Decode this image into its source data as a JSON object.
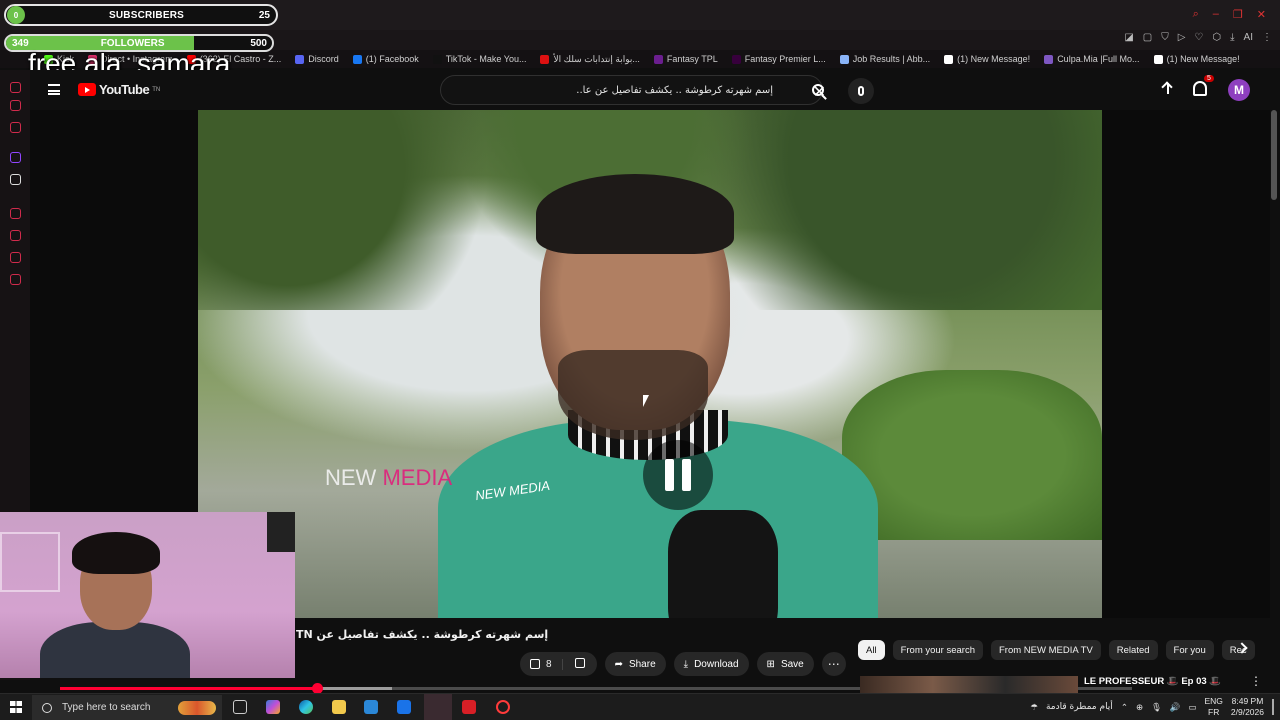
{
  "overlay": {
    "subscribers": {
      "label": "SUBSCRIBERS",
      "count": "25",
      "progress": 0.05
    },
    "followers": {
      "current": "349",
      "label": "FOLLOWERS",
      "goal": "500",
      "progress": 0.698
    },
    "handle": "free ala_samara"
  },
  "browser": {
    "bookmarks": [
      {
        "label": "Kick",
        "color": "#53fc18"
      },
      {
        "label": "Direct • Instagram",
        "color": "#e1306c"
      },
      {
        "label": "(362) El Castro - Z...",
        "color": "#ff0000"
      },
      {
        "label": "Discord",
        "color": "#5865f2"
      },
      {
        "label": "(1) Facebook",
        "color": "#1877f2"
      },
      {
        "label": "TikTok - Make You...",
        "color": "#111111"
      },
      {
        "label": "بوابة إنتدابات سلك الأ...",
        "color": "#d11"
      },
      {
        "label": "Fantasy TPL",
        "color": "#6b1e8f"
      },
      {
        "label": "Fantasy Premier L...",
        "color": "#37003c"
      },
      {
        "label": "Job Results | Abb...",
        "color": "#8ab4f8"
      },
      {
        "label": "(1) New Message!",
        "color": "#ffffff"
      },
      {
        "label": "Culpa.Mia |Full Mo...",
        "color": "#7e57c2"
      },
      {
        "label": "(1) New Message!",
        "color": "#ffffff"
      }
    ]
  },
  "youtube": {
    "logo_text": "YouTube",
    "logo_region": "TN",
    "search_value": "إسم شهرته كرطوشة .. يكشف تفاصيل عن عا..",
    "notification_count": "5",
    "avatar_letter": "M",
    "video": {
      "watermark_main": "NEW ",
      "watermark_accent": "MEDIA",
      "mic_label": "NEW MEDIA",
      "progress": 0.24,
      "buffered": 0.31
    },
    "title": "إسم شهرته كرطوشة .. يكشف تفاصيل عن TN",
    "actions": {
      "likes": "8",
      "share": "Share",
      "download": "Download",
      "save": "Save"
    },
    "chips": [
      "All",
      "From your search",
      "From NEW MEDIA TV",
      "Related",
      "For you",
      "Rec"
    ],
    "recommended": {
      "title": "LE PROFESSEUR 🎩 Ep 03 🎩"
    }
  },
  "taskbar": {
    "search_placeholder": "Type here to search",
    "weather": "أيام ممطرة قادمة",
    "lang_top": "ENG",
    "lang_bottom": "FR",
    "time": "8:49 PM",
    "date": "2/9/2026"
  }
}
